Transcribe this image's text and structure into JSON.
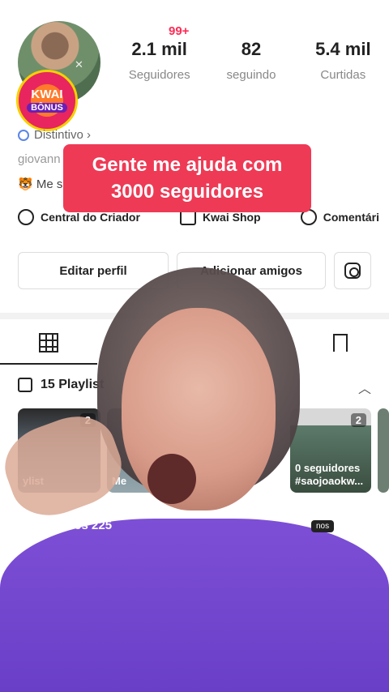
{
  "profile": {
    "notifications": "99+",
    "stats": [
      {
        "value": "2.1 mil",
        "label": "Seguidores"
      },
      {
        "value": "82",
        "label": "seguindo"
      },
      {
        "value": "5.4 mil",
        "label": "Curtidas"
      }
    ],
    "badge": {
      "line1": "KWAI",
      "line2": "BÔNUS"
    },
    "distintivo": "Distintivo ›",
    "username": "giovann",
    "bio": "🐯 Me s"
  },
  "caption": {
    "line1": "Gente me ajuda com",
    "line2": "3000 seguidores"
  },
  "links": {
    "creator": "Central do Criador",
    "shop": "Kwai Shop",
    "comments": "Comentári"
  },
  "buttons": {
    "edit": "Editar perfil",
    "add": "Adicionar amigos"
  },
  "playlists": {
    "header": "15 Playlist",
    "items": [
      {
        "count": "2",
        "title": "ylist"
      },
      {
        "count": "",
        "title": "Me"
      },
      {
        "count": "2",
        "title": "0 seguidores #saojoaokw..."
      }
    ]
  },
  "drafts": {
    "label": "Rascunhos 225",
    "tag": "nos"
  }
}
